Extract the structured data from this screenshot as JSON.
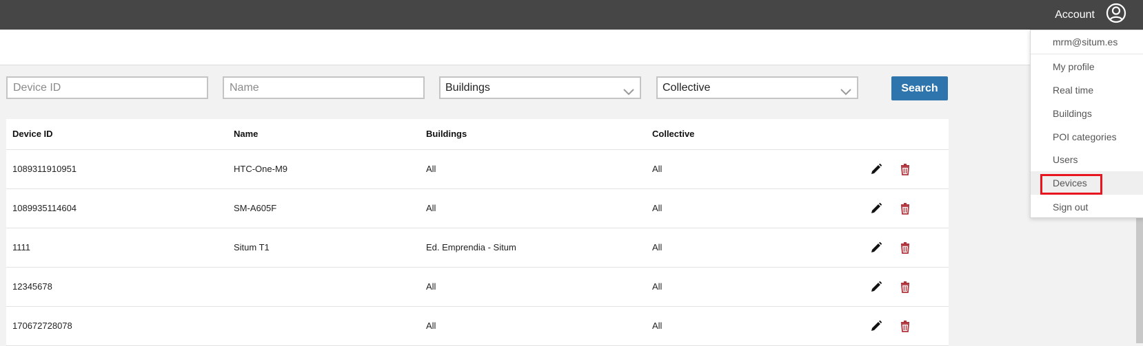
{
  "header": {
    "account_label": "Account",
    "avatar_icon": "user-circle-icon"
  },
  "filters": {
    "device_id_placeholder": "Device ID",
    "name_placeholder": "Name",
    "buildings_selected": "Buildings",
    "collective_selected": "Collective",
    "search_label": "Search"
  },
  "table": {
    "columns": [
      "Device ID",
      "Name",
      "Buildings",
      "Collective"
    ],
    "rows": [
      {
        "device_id": "1089311910951",
        "name": "HTC-One-M9",
        "buildings": "All",
        "collective": "All"
      },
      {
        "device_id": "1089935114604",
        "name": "SM-A605F",
        "buildings": "All",
        "collective": "All"
      },
      {
        "device_id": "1111",
        "name": "Situm T1",
        "buildings": "Ed. Emprendia - Situm",
        "collective": "All"
      },
      {
        "device_id": "12345678",
        "name": "",
        "buildings": "All",
        "collective": "All"
      },
      {
        "device_id": "170672728078",
        "name": "",
        "buildings": "All",
        "collective": "All"
      }
    ],
    "edit_icon": "pencil-icon",
    "delete_icon": "trash-icon"
  },
  "account_menu": {
    "email": "mrm@situm.es",
    "items": [
      {
        "label": "My profile"
      },
      {
        "label": "Real time"
      },
      {
        "label": "Buildings"
      },
      {
        "label": "POI categories"
      },
      {
        "label": "Users"
      },
      {
        "label": "Devices",
        "active": true
      },
      {
        "label": "Sign out"
      }
    ]
  },
  "colors": {
    "topbar": "#464646",
    "search_button": "#2e74ad",
    "delete_icon": "#b0323a",
    "highlight": "#e8141e"
  }
}
